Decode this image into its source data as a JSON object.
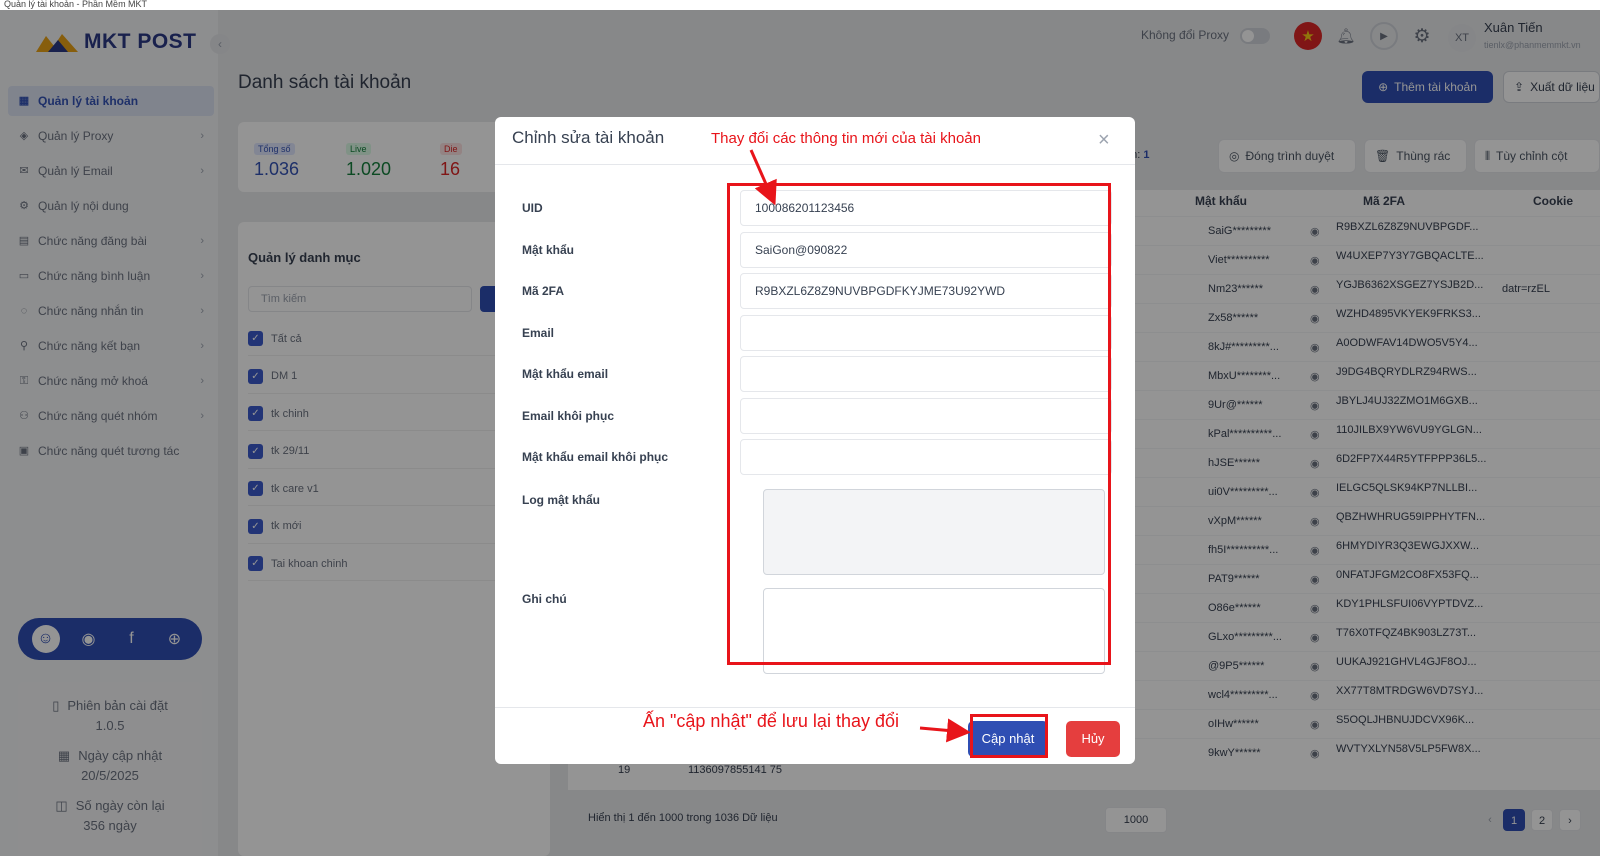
{
  "window_title": "Quản lý tài khoản - Phần Mềm MKT",
  "logo_text": "MKT POST",
  "sidebar": {
    "items": [
      {
        "label": "Quản lý tài khoản",
        "icon": "grid-icon",
        "glyph": "▦",
        "chevron": ""
      },
      {
        "label": "Quản lý Proxy",
        "icon": "layers-icon",
        "glyph": "◈",
        "chevron": "›"
      },
      {
        "label": "Quản lý Email",
        "icon": "mail-icon",
        "glyph": "✉",
        "chevron": "›"
      },
      {
        "label": "Quản lý nội dung",
        "icon": "content-icon",
        "glyph": "⚙",
        "chevron": ""
      },
      {
        "label": "Chức năng đăng bài",
        "icon": "post-icon",
        "glyph": "▤",
        "chevron": "›"
      },
      {
        "label": "Chức năng bình luận",
        "icon": "comment-icon",
        "glyph": "▭",
        "chevron": "›"
      },
      {
        "label": "Chức năng nhắn tin",
        "icon": "message-icon",
        "glyph": "◌",
        "chevron": "›"
      },
      {
        "label": "Chức năng kết bạn",
        "icon": "add-friend-icon",
        "glyph": "⚲",
        "chevron": "›"
      },
      {
        "label": "Chức năng mở khoá",
        "icon": "unlock-icon",
        "glyph": "⚿",
        "chevron": "›"
      },
      {
        "label": "Chức năng quét nhóm",
        "icon": "group-icon",
        "glyph": "⚇",
        "chevron": "›"
      },
      {
        "label": "Chức năng quét tương tác",
        "icon": "scan-icon",
        "glyph": "▣",
        "chevron": ""
      }
    ],
    "info": {
      "version_label": "Phiên bản cài đặt",
      "version_value": "1.0.5",
      "update_label": "Ngày cập nhật",
      "update_value": "20/5/2025",
      "days_label": "Số ngày còn lại",
      "days_value": "356 ngày"
    }
  },
  "topbar": {
    "proxy_label": "Không đổi Proxy",
    "avatar_initials": "XT",
    "user_name": "Xuân Tiến",
    "user_email": "tienlx@phanmemmkt.vn"
  },
  "page": {
    "title": "Danh sách tài khoản",
    "add_button": "Thêm tài khoản",
    "export_button": "Xuất dữ liệu"
  },
  "stats": [
    {
      "label": "Tổng số",
      "value": "1.036",
      "color": "#3553b5",
      "bg": "#e0e7ff"
    },
    {
      "label": "Live",
      "value": "1.020",
      "color": "#15803d",
      "bg": "#dcfce7"
    },
    {
      "label": "Die",
      "value": "16",
      "color": "#dc2626",
      "bg": "#fee2e2"
    }
  ],
  "categories": {
    "title": "Quản lý danh mục",
    "search_placeholder": "Tìm kiếm",
    "items": [
      "Tất cả",
      "DM 1",
      "tk chinh",
      "tk 29/11",
      "tk care v1",
      "tk mới",
      "Tai khoan chinh"
    ]
  },
  "toolbar": {
    "count_prefix": "on:",
    "count_value": "1",
    "close_browser": "Đóng trình duyệt",
    "trash": "Thùng rác",
    "columns": "Tùy chỉnh cột"
  },
  "table": {
    "headers": {
      "password": "Mật khẩu",
      "twofa": "Mã 2FA",
      "cookie": "Cookie"
    },
    "rows": [
      {
        "pw": "SaiG*********",
        "fa": "R9BXZL6Z8Z9NUVBPGDF...",
        "ck": ""
      },
      {
        "pw": "Viet**********",
        "fa": "W4UXEP7Y3Y7GBQACLTE...",
        "ck": ""
      },
      {
        "pw": "Nm23******",
        "fa": "YGJB6362XSGEZ7YSJB2D...",
        "ck": "datr=rzEL"
      },
      {
        "pw": "Zx58******",
        "fa": "WZHD4895VKYEK9FRKS3...",
        "ck": ""
      },
      {
        "pw": "8kJ#*********...",
        "fa": "A0ODWFAV14DWO5V5Y4...",
        "ck": ""
      },
      {
        "pw": "MbxU********...",
        "fa": "J9DG4BQRYDLRZ94RWS...",
        "ck": ""
      },
      {
        "pw": "9Ur@******",
        "fa": "JBYLJ4UJ32ZMO1M6GXB...",
        "ck": ""
      },
      {
        "pw": "kPal**********...",
        "fa": "110JILBX9YW6VU9YGLGN...",
        "ck": ""
      },
      {
        "pw": "hJSE******",
        "fa": "6D2FP7X44R5YTFPPP36L5...",
        "ck": ""
      },
      {
        "pw": "ui0V*********...",
        "fa": "IELGC5QLSK94KP7NLLBI...",
        "ck": ""
      },
      {
        "pw": "vXpM******",
        "fa": "QBZHWHRUG59IPPHYTFN...",
        "ck": ""
      },
      {
        "pw": "fh5I**********...",
        "fa": "6HMYDIYR3Q3EWGJXXW...",
        "ck": ""
      },
      {
        "pw": "PAT9******",
        "fa": "0NFATJFGM2CO8FX53FQ...",
        "ck": ""
      },
      {
        "pw": "O86e******",
        "fa": "KDY1PHLSFUI06VYPTDVZ...",
        "ck": ""
      },
      {
        "pw": "GLxo*********...",
        "fa": "T76X0TFQZ4BK903LZ73T...",
        "ck": ""
      },
      {
        "pw": "@9P5******",
        "fa": "UUKAJ921GHVL4GJF8OJ...",
        "ck": ""
      },
      {
        "pw": "wcl4*********...",
        "fa": "XX77T8MTRDGW6VD7SYJ...",
        "ck": ""
      },
      {
        "pw": "oIHw******",
        "fa": "S5OQLJHBNUJDCVX96K...",
        "ck": ""
      },
      {
        "pw": "9kwY******",
        "fa": "WVTYXLYN58V5LP5FW8X...",
        "ck": ""
      }
    ],
    "visible_row_index": "19",
    "visible_row_uid": "1136097855141 75",
    "footer": "Hiển thị 1 đến 1000 trong 1036 Dữ liệu",
    "per_page": "1000",
    "pages": [
      "1",
      "2"
    ]
  },
  "modal": {
    "title": "Chỉnh sửa tài khoản",
    "fields": [
      {
        "label": "UID",
        "value": "100086201123456"
      },
      {
        "label": "Mật khẩu",
        "value": "SaiGon@090822"
      },
      {
        "label": "Mã 2FA",
        "value": "R9BXZL6Z8Z9NUVBPGDFKYJME73U92YWD"
      },
      {
        "label": "Email",
        "value": ""
      },
      {
        "label": "Mật khẩu email",
        "value": ""
      },
      {
        "label": "Email khôi phục",
        "value": ""
      },
      {
        "label": "Mật khẩu email khôi phục",
        "value": ""
      }
    ],
    "log_label": "Log mật khẩu",
    "note_label": "Ghi chú",
    "update_button": "Cập nhật",
    "cancel_button": "Hủy"
  },
  "annotations": {
    "top_text": "Thay đổi các thông tin mới của tài khoản",
    "bottom_text": "Ấn \"cập nhật\" để lưu lại thay đổi",
    "color": "#e8141a"
  }
}
